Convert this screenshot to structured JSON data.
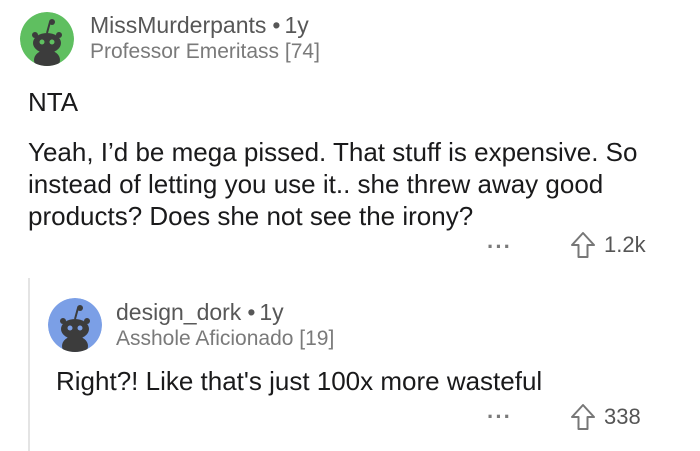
{
  "comment1": {
    "username": "MissMurderpants",
    "age": "1y",
    "flair": "Professor Emeritass [74]",
    "lines": [
      "NTA",
      "Yeah, I’d be mega pissed. That stuff is expensive. So",
      "instead of letting you use it.. she threw away good",
      "products?  Does she not see the irony?"
    ],
    "more": "···",
    "upvotes": "1.2k",
    "avatar_color": "#5fbf60"
  },
  "comment2": {
    "username": "design_dork",
    "age": "1y",
    "flair": "Asshole Aficionado [19]",
    "text": "Right?! Like that's just 100x more wasteful",
    "more": "···",
    "upvotes": "338",
    "avatar_color": "#7b9fe6"
  },
  "separator": "•"
}
